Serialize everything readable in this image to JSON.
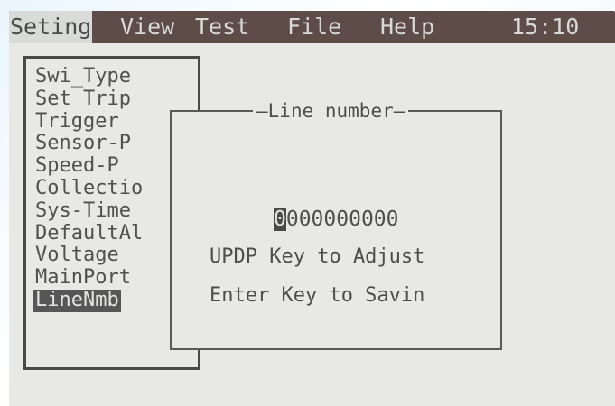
{
  "menubar": {
    "items": [
      "Seting",
      "View",
      "Test",
      "File",
      "Help"
    ],
    "active_index": 0,
    "clock": "15:10"
  },
  "side_menu": {
    "items": [
      "Swi_Type",
      "Set Trip",
      "Trigger",
      "Sensor-P",
      "Speed-P",
      "Collectio",
      "Sys-Time",
      "DefaultAl",
      "Voltage",
      "MainPort",
      "LineNmb"
    ],
    "selected_index": 10
  },
  "dialog": {
    "title": "Line number",
    "value_cursor_digit": "0",
    "value_rest": "000000000",
    "line1": "UPDP Key to Adjust",
    "line2": "Enter Key to Savin"
  },
  "colors": {
    "menubar_bg": "#5e4c49",
    "screen_bg": "#e8e9e6",
    "text": "#4e4e4e"
  }
}
